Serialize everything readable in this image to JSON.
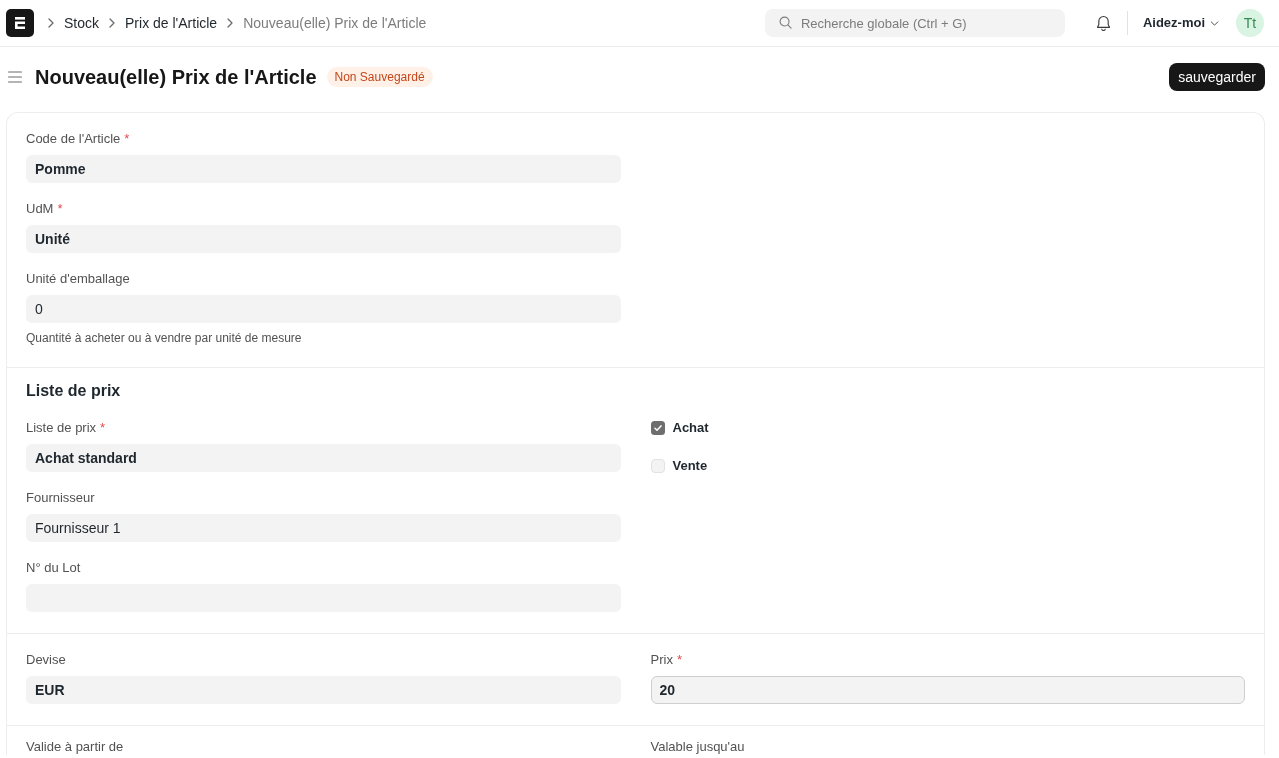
{
  "navbar": {
    "breadcrumbs": [
      {
        "label": "Stock",
        "current": false
      },
      {
        "label": "Prix de l'Article",
        "current": false
      },
      {
        "label": "Nouveau(elle) Prix de l'Article",
        "current": true
      }
    ],
    "search": {
      "placeholder": "Recherche globale (Ctrl + G)"
    },
    "help_menu": "Aidez-moi",
    "avatar": "Tt"
  },
  "page_header": {
    "title": "Nouveau(elle) Prix de l'Article",
    "status_badge": "Non Sauvegardé",
    "save_button": "sauvegarder"
  },
  "sections": [
    {
      "columns": [
        [
          {
            "kind": "field",
            "label": "Code de l'Article",
            "required_mark": "*",
            "value": "Pomme",
            "bold": true,
            "focused": false
          },
          {
            "kind": "field",
            "label": "UdM",
            "required_mark": "*",
            "value": "Unité",
            "bold": true,
            "focused": false
          },
          {
            "kind": "field",
            "label": "Unité d'emballage",
            "value": "0",
            "bold": false,
            "focused": false,
            "description": "Quantité à acheter ou à vendre par unité de mesure"
          }
        ]
      ]
    },
    {
      "heading": "Liste de prix",
      "columns": [
        [
          {
            "kind": "field",
            "label": "Liste de prix",
            "required_mark": "*",
            "value": "Achat standard",
            "bold": true,
            "focused": false
          },
          {
            "kind": "field",
            "label": "Fournisseur",
            "value": "Fournisseur 1",
            "bold": false,
            "focused": false
          },
          {
            "kind": "field",
            "label": "N° du Lot",
            "focused": false
          }
        ],
        [
          {
            "kind": "checkbox",
            "label": "Achat",
            "checked": true
          },
          {
            "kind": "checkbox",
            "label": "Vente",
            "checked": false
          }
        ]
      ]
    },
    {
      "columns": [
        [
          {
            "kind": "field",
            "label": "Devise",
            "value": "EUR",
            "bold": true,
            "focused": false
          }
        ],
        [
          {
            "kind": "field",
            "label": "Prix",
            "required_mark": "*",
            "value": "20",
            "bold": true,
            "focused": true
          }
        ]
      ]
    },
    {
      "columns": [
        [
          {
            "kind": "caption",
            "label": "Valide à partir de"
          }
        ],
        [
          {
            "kind": "caption",
            "label": "Valable jusqu'au"
          }
        ]
      ]
    }
  ]
}
